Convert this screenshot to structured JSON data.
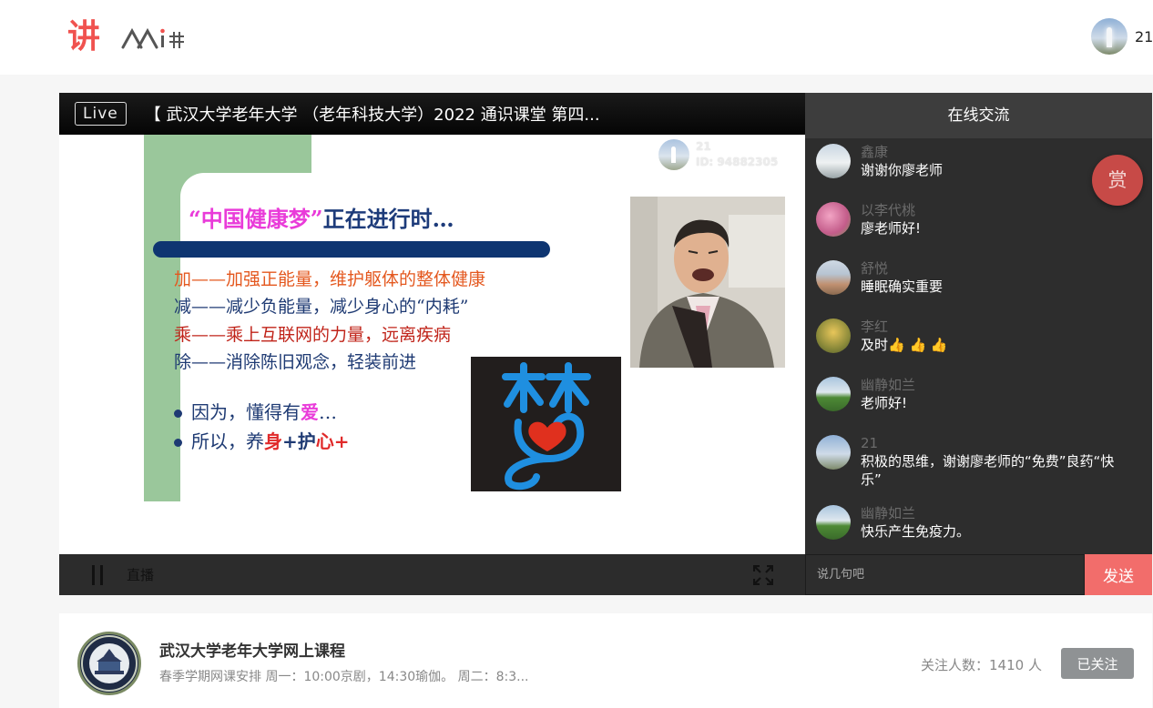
{
  "header": {
    "logo_mark": "讲",
    "logo_wordmark": "人人讲",
    "user": {
      "name": "21",
      "avatar_icon": "avatar-geyser"
    }
  },
  "player": {
    "live_badge": "Live",
    "title": "【 武汉大学老年大学 （老年科技大学）2022 通识课堂 第四...",
    "watermark": {
      "name": "21",
      "id": "ID: 94882305"
    },
    "slide": {
      "heading_quote": "“中国健康梦”",
      "heading_rest": "正在进行时…",
      "lines": [
        "加——加强正能量，维护躯体的整体健康",
        "减——减少负能量，减少身心的“内耗”",
        "乘——乘上互联网的力量，远离疾病",
        "除——消除陈旧观念，轻装前进"
      ],
      "bullet1_a": "因为，懂得有",
      "bullet1_b": "爱",
      "bullet1_c": "…",
      "bullet2_a": "所以，养",
      "bullet2_b": "身",
      "bullet2_c": "+护",
      "bullet2_d": "心+",
      "dream_char": "梦"
    },
    "controls": {
      "status_label": "直播",
      "pause_icon": "pause-icon",
      "fullscreen_icon": "fullscreen-icon"
    }
  },
  "chat": {
    "title": "在线交流",
    "reward_label": "赏",
    "messages": [
      {
        "name": "鑫康",
        "text": "谢谢你廖老师"
      },
      {
        "name": "以李代桃",
        "text": "廖老师好!"
      },
      {
        "name": "舒悦",
        "text": "睡眠确实重要"
      },
      {
        "name": "李红",
        "text": "及时👍 👍 👍"
      },
      {
        "name": "幽静如兰",
        "text": "老师好!"
      },
      {
        "name": "21",
        "text": "积极的思维，谢谢廖老师的“免费”良药“快乐”"
      },
      {
        "name": "幽静如兰",
        "text": "快乐产生免疫力。"
      }
    ],
    "input_placeholder": "说几句吧",
    "send_label": "发送"
  },
  "channel": {
    "name": "武汉大学老年大学网上课程",
    "description": "春季学期网课安排 周一：10:00京剧，14:30瑜伽。 周二：8:3...",
    "followers": "关注人数：1410 人",
    "follow_button": "已关注"
  },
  "colors": {
    "brand_red": "#f0524f",
    "send_button": "#f26d6b",
    "reward_button": "#c74a47",
    "chat_bg": "#2d2d2d"
  }
}
